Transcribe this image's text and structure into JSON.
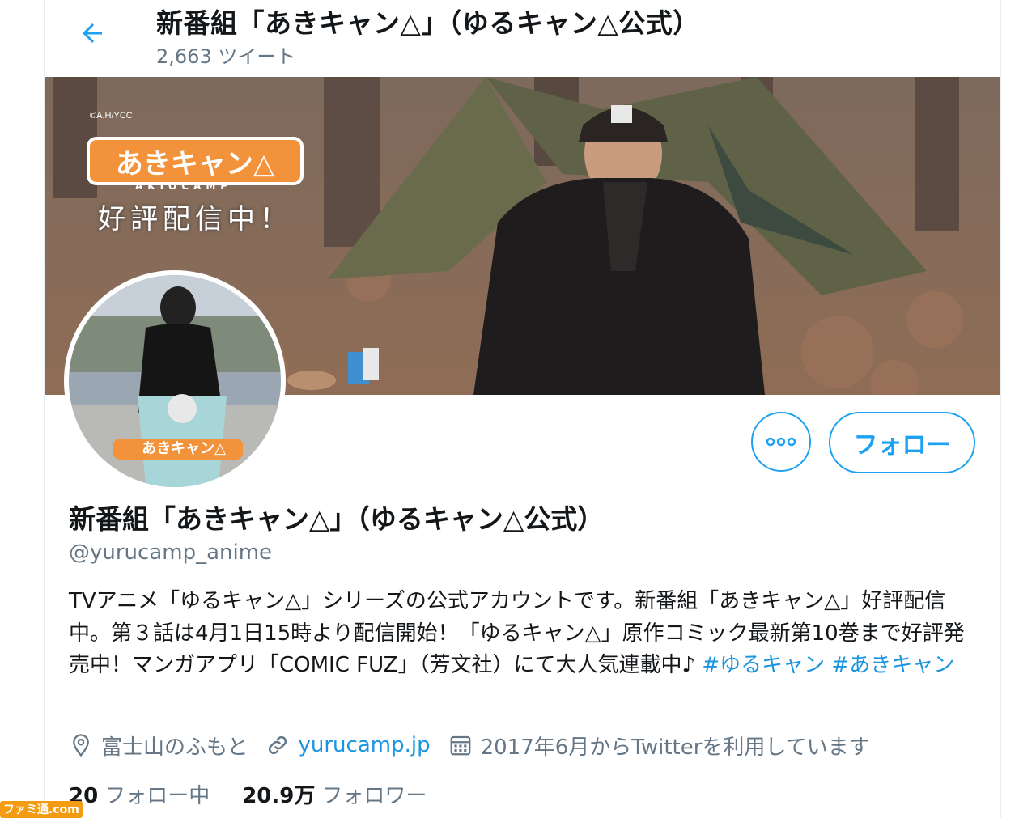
{
  "header": {
    "title": "新番組「あきキャン△」（ゆるキャン△公式）",
    "tweet_count": "2,663 ツイート"
  },
  "banner": {
    "copyright": "©A.H/YCC",
    "logo_text": "あきキャン△",
    "logo_sub": "AKIOCAMP",
    "streaming_text": "好評配信中！"
  },
  "avatar": {
    "logo_text": "あきキャン△"
  },
  "actions": {
    "follow_label": "フォロー"
  },
  "profile": {
    "name": "新番組「あきキャン△」（ゆるキャン△公式）",
    "handle": "@yurucamp_anime",
    "bio_text": "TVアニメ「ゆるキャン△」シリーズの公式アカウントです。新番組「あきキャン△」好評配信中。第３話は4月1日15時より配信開始！「ゆるキャン△」原作コミック最新第10巻まで好評発売中！マンガアプリ「COMIC FUZ」（芳文社）にて大人気連載中♪ ",
    "hashtags": [
      "#ゆるキャン",
      "#あきキャン"
    ],
    "location": "富士山のふもと",
    "website": "yurucamp.jp",
    "joined": "2017年6月からTwitterを利用しています"
  },
  "stats": {
    "following_count": "20",
    "following_label": "フォロー中",
    "followers_count": "20.9万",
    "followers_label": "フォロワー"
  },
  "watermark": "ファミ通.com",
  "colors": {
    "accent": "#1da1f2",
    "link": "#1b95e0",
    "muted": "#657786"
  }
}
